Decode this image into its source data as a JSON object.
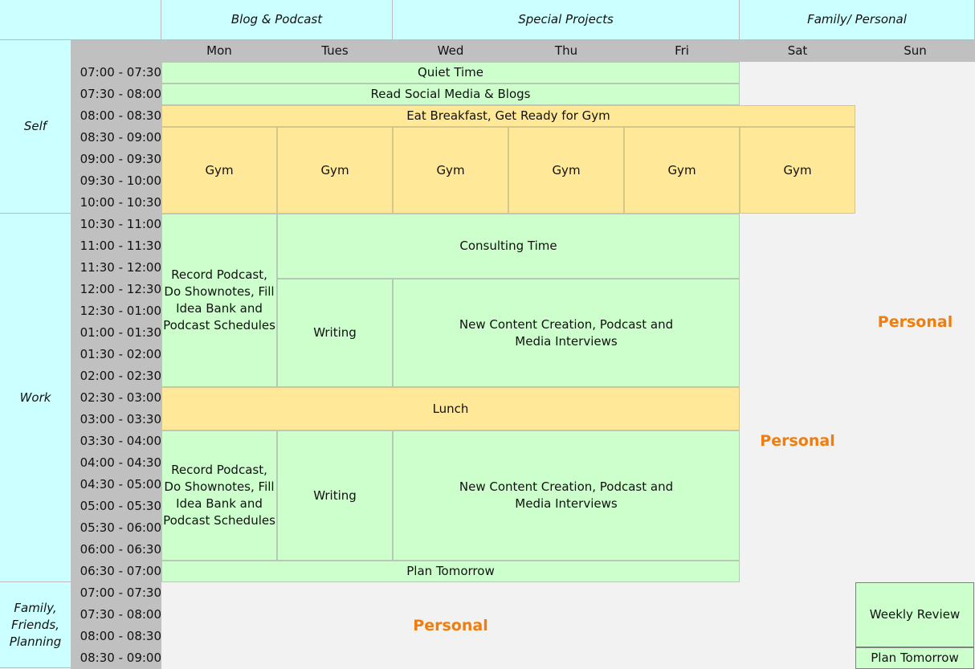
{
  "header": {
    "groups": [
      "Blog & Podcast",
      "Special Projects",
      "Family/ Personal"
    ]
  },
  "days": [
    "Mon",
    "Tues",
    "Wed",
    "Thu",
    "Fri",
    "Sat",
    "Sun"
  ],
  "categories": [
    "Self",
    "Work",
    "Family, Friends, Planning"
  ],
  "times": [
    "07:00 - 07:30",
    "07:30 - 08:00",
    "08:00 - 08:30",
    "08:30 - 09:00",
    "09:00 - 09:30",
    "09:30 - 10:00",
    "10:00 - 10:30",
    "10:30 - 11:00",
    "11:00 - 11:30",
    "11:30 - 12:00",
    "12:00 - 12:30",
    "12:30 - 01:00",
    "01:00 - 01:30",
    "01:30 - 02:00",
    "02:00 - 02:30",
    "02:30 - 03:00",
    "03:00 - 03:30",
    "03:30 - 04:00",
    "04:00 - 04:30",
    "04:30 - 05:00",
    "05:00 - 05:30",
    "05:30 - 06:00",
    "06:00 - 06:30",
    "06:30 - 07:00",
    "07:00 - 07:30",
    "07:30 - 08:00",
    "08:00 - 08:30",
    "08:30 - 09:00"
  ],
  "blocks": {
    "quiet": "Quiet Time",
    "social": "Read Social Media & Blogs",
    "breakfast": "Eat Breakfast, Get Ready for Gym",
    "gym": "Gym",
    "record": "Record Podcast, Do Shownotes, Fill Idea Bank and Podcast Schedules",
    "consulting": "Consulting Time",
    "writing": "Writing",
    "content": "New Content Creation, Podcast and Media Interviews",
    "lunch": "Lunch",
    "plan": "Plan Tomorrow",
    "personal": "Personal",
    "weekly": "Weekly Review"
  },
  "colors": {
    "header": "#ccffff",
    "green": "#ccffcc",
    "yellow": "#ffe999",
    "gray": "#c0c0c0",
    "personal": "#f07d0c"
  }
}
